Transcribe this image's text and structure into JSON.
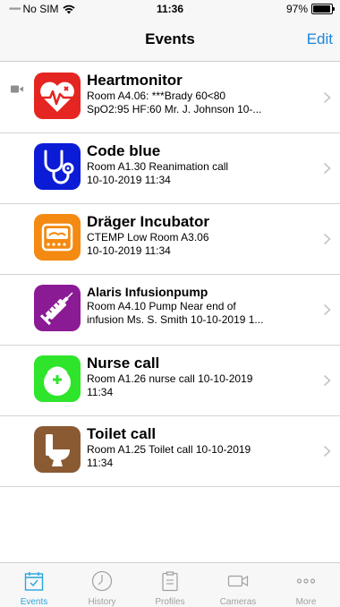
{
  "status_bar": {
    "carrier": "No SIM",
    "time": "11:36",
    "battery": "97%"
  },
  "nav": {
    "title": "Events",
    "edit_label": "Edit"
  },
  "events": [
    {
      "title": "Heartmonitor",
      "detail": "Room A4.06: ***Brady 60<80\nSpO2:95 HF:60 Mr. J. Johnson 10-...",
      "icon": "heartmonitor-icon",
      "icon_color": "#e52521",
      "has_camera": true
    },
    {
      "title": "Code blue",
      "detail": "Room A1.30 Reanimation call\n10-10-2019 11:34",
      "icon": "stethoscope-icon",
      "icon_color": "#0b1bd6"
    },
    {
      "title": "Dräger Incubator",
      "detail": "CTEMP Low Room A3.06\n10-10-2019 11:34",
      "icon": "incubator-icon",
      "icon_color": "#f48a12"
    },
    {
      "title": "Alaris Infusionpump",
      "detail": "Room A4.10 Pump Near end of\ninfusion Ms. S. Smith 10-10-2019 1...",
      "icon": "syringe-icon",
      "icon_color": "#8b1a95"
    },
    {
      "title": "Nurse call",
      "detail": "Room A1.26 nurse call 10-10-2019\n11:34",
      "icon": "nurse-call-icon",
      "icon_color": "#2ee52b"
    },
    {
      "title": "Toilet call",
      "detail": "Room A1.25 Toilet call 10-10-2019\n11:34",
      "icon": "toilet-icon",
      "icon_color": "#8a5a33"
    }
  ],
  "tabs": [
    {
      "label": "Events",
      "icon": "calendar-check-icon",
      "active": true
    },
    {
      "label": "History",
      "icon": "clock-icon"
    },
    {
      "label": "Profiles",
      "icon": "clipboard-icon"
    },
    {
      "label": "Cameras",
      "icon": "video-camera-icon"
    },
    {
      "label": "More",
      "icon": "more-dots-icon"
    }
  ],
  "colors": {
    "accent": "#1a84d8",
    "tab_active": "#29a6dc",
    "tab_inactive": "#a0a0a0"
  }
}
